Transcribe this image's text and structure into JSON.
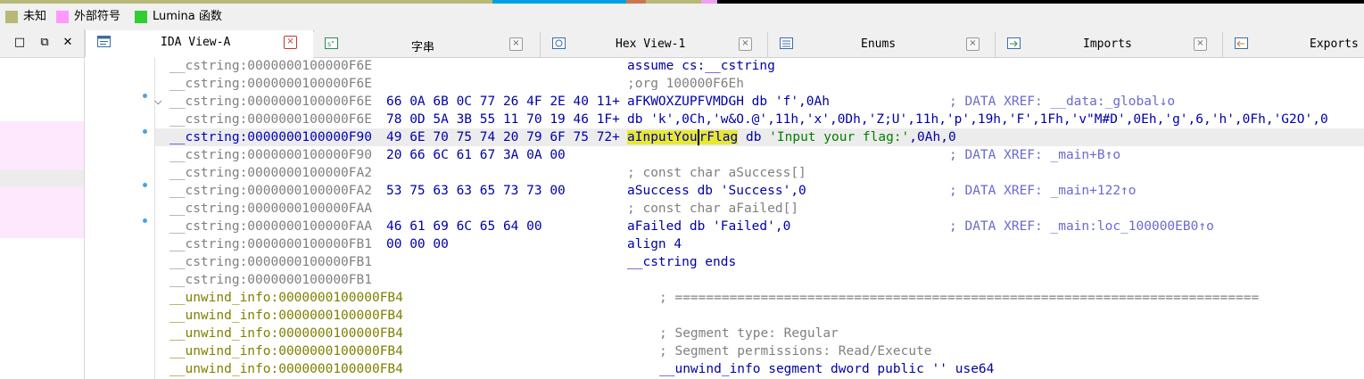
{
  "navstrip_colors": [
    "#b8b878",
    "#00a0e0",
    "#c87850",
    "#b0b0b0",
    "#f0a0f0",
    "#000000"
  ],
  "legend": [
    {
      "color": "#b8b878",
      "label": "未知"
    },
    {
      "color": "#ff99ff",
      "label": "外部符号"
    },
    {
      "color": "#33cc33",
      "label": "Lumina 函数"
    }
  ],
  "left_panel": {
    "buttons": {
      "restore": "□",
      "float": "⧉",
      "close": "✕"
    }
  },
  "tabs": [
    {
      "label": "IDA View-A",
      "icon": "ida-view-icon",
      "active": true
    },
    {
      "label": "字串",
      "icon": "strings-icon",
      "active": false
    },
    {
      "label": "Hex View-1",
      "icon": "hex-view-icon",
      "active": false
    },
    {
      "label": "Enums",
      "icon": "enums-icon",
      "active": false
    },
    {
      "label": "Imports",
      "icon": "imports-icon",
      "active": false
    },
    {
      "label": "Exports",
      "icon": "exports-icon",
      "active": false
    }
  ],
  "tab_close_glyph": "×",
  "lines": [
    {
      "addr": "__cstring:0000000100000F6E",
      "bytes": "",
      "code": "assume cs:__cstring",
      "comment": ""
    },
    {
      "addr": "__cstring:0000000100000F6E",
      "bytes": "",
      "code": ";org 100000F6Eh",
      "comment": ""
    },
    {
      "addr": "__cstring:0000000100000F6E",
      "bytes": "66 0A 6B 0C 77 26 4F 2E 40 11+",
      "code": "aFKWOXZUPFVMDGH db 'f',0Ah",
      "comment": "; DATA XREF: __data:_global↓o"
    },
    {
      "addr": "__cstring:0000000100000F6E",
      "bytes": "78 0D 5A 3B 55 11 70 19 46 1F+",
      "code": "db 'k',0Ch,'w&O.@',11h,'x',0Dh,'Z;U',11h,'p',19h,'F',1Fh,'v\"M#D',0Eh,'g',6,'h',0Fh,'G2O',0",
      "comment": ""
    },
    {
      "addr": "__cstring:0000000100000F90",
      "bytes": "49 6E 70 75 74 20 79 6F 75 72+",
      "code_pre": "aInputYou",
      "code_post": "rFlag",
      "code_rest": " db ",
      "code_str": "'Input your flag:'",
      "code_tail": ",0Ah,0",
      "comment": ""
    },
    {
      "addr": "__cstring:0000000100000F90",
      "bytes": "20 66 6C 61 67 3A 0A 00",
      "code": "",
      "comment": "; DATA XREF: _main+B↑o"
    },
    {
      "addr": "__cstring:0000000100000FA2",
      "bytes": "",
      "code": "; const char aSuccess[]",
      "comment": ""
    },
    {
      "addr": "__cstring:0000000100000FA2",
      "bytes": "53 75 63 63 65 73 73 00",
      "code": "aSuccess db 'Success',0",
      "comment": "; DATA XREF: _main+122↑o"
    },
    {
      "addr": "__cstring:0000000100000FAA",
      "bytes": "",
      "code": "; const char aFailed[]",
      "comment": ""
    },
    {
      "addr": "__cstring:0000000100000FAA",
      "bytes": "46 61 69 6C 65 64 00",
      "code": "aFailed db 'Failed',0",
      "comment": "; DATA XREF: _main:loc_100000EB0↑o"
    },
    {
      "addr": "__cstring:0000000100000FB1",
      "bytes": "00 00 00",
      "code": "align 4",
      "comment": ""
    },
    {
      "addr": "__cstring:0000000100000FB1",
      "bytes": "",
      "code": "__cstring ends",
      "comment": ""
    },
    {
      "addr": "__cstring:0000000100000FB1",
      "bytes": "",
      "code": "",
      "comment": ""
    },
    {
      "addr": "__unwind_info:0000000100000FB4",
      "bytes": "",
      "code": "; ===========================================================================",
      "comment": ""
    },
    {
      "addr": "__unwind_info:0000000100000FB4",
      "bytes": "",
      "code": "",
      "comment": ""
    },
    {
      "addr": "__unwind_info:0000000100000FB4",
      "bytes": "",
      "code": "; Segment type: Regular",
      "comment": ""
    },
    {
      "addr": "__unwind_info:0000000100000FB4",
      "bytes": "",
      "code": "; Segment permissions: Read/Execute",
      "comment": ""
    },
    {
      "addr": "__unwind_info:0000000100000FB4",
      "bytes": "",
      "code": "__unwind_info segment dword public '' use64",
      "comment": ""
    }
  ]
}
